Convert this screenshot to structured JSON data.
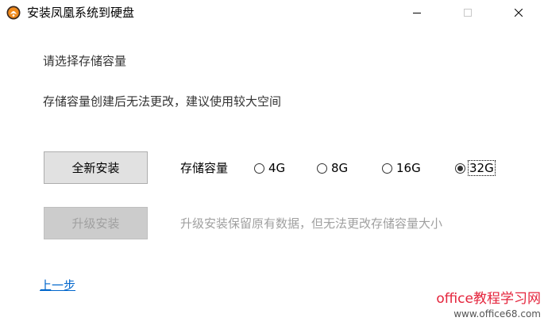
{
  "window": {
    "title": "安装凤凰系统到硬盘",
    "icon": "phoenix-app-icon",
    "controls": [
      "minimize-icon",
      "maximize-icon",
      "close-icon"
    ]
  },
  "content": {
    "heading": "请选择存储容量",
    "hint": "存储容量创建后无法更改，建议使用较大空间"
  },
  "buttons": {
    "new_install": "全新安装",
    "upgrade_install": "升级安装"
  },
  "capacity": {
    "label": "存储容量",
    "options": [
      "4G",
      "8G",
      "16G",
      "32G"
    ],
    "selected": "32G"
  },
  "upgrade_note": "升级安装保留原有数据，但无法更改存储容量大小",
  "back_link": "上一步",
  "watermark": {
    "main": "office教程学习网",
    "url": "www.office68.com"
  },
  "colors": {
    "link": "#0066cc",
    "watermark": "#e4233b",
    "disabled_text": "#a0a0a0"
  }
}
